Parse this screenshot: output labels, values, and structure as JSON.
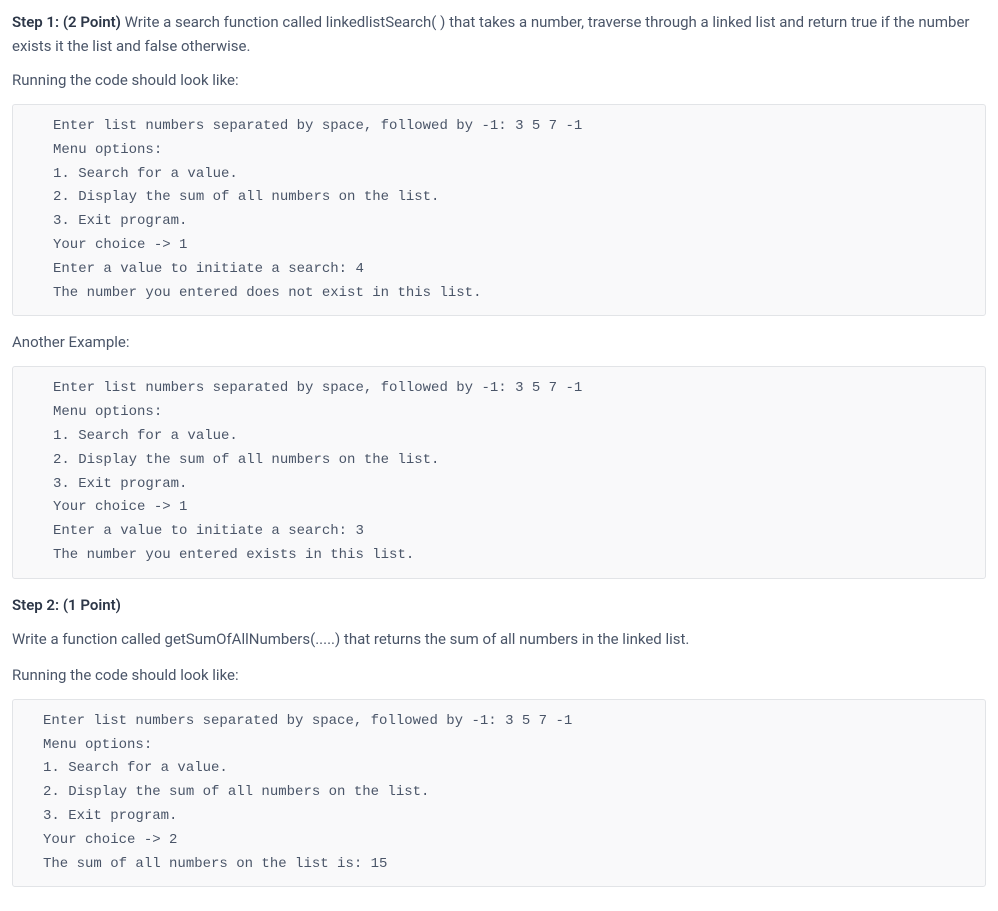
{
  "step1": {
    "title": "Step 1: (2 Point) ",
    "desc": "Write a search function called linkedlistSearch( ) that takes a number, traverse through a linked list and return true if the number exists it the list and false otherwise.",
    "running_label": "Running the code should look like:",
    "code1": "Enter list numbers separated by space, followed by -1: 3 5 7 -1\nMenu options:\n1. Search for a value.\n2. Display the sum of all numbers on the list.\n3. Exit program.\nYour choice -> 1\nEnter a value to initiate a search: 4\nThe number you entered does not exist in this list.",
    "another_label": "Another Example:",
    "code2": "Enter list numbers separated by space, followed by -1: 3 5 7 -1\nMenu options:\n1. Search for a value.\n2. Display the sum of all numbers on the list.\n3. Exit program.\nYour choice -> 1\nEnter a value to initiate a search: 3\nThe number you entered exists in this list."
  },
  "step2": {
    "title": "Step 2: (1 Point)",
    "desc": "Write a function called getSumOfAllNumbers(.....) that returns the sum of all numbers in the linked list.",
    "running_label": "Running the code should look like:",
    "code1": "Enter list numbers separated by space, followed by -1: 3 5 7 -1\nMenu options:\n1. Search for a value.\n2. Display the sum of all numbers on the list.\n3. Exit program.\nYour choice -> 2\nThe sum of all numbers on the list is: 15"
  }
}
